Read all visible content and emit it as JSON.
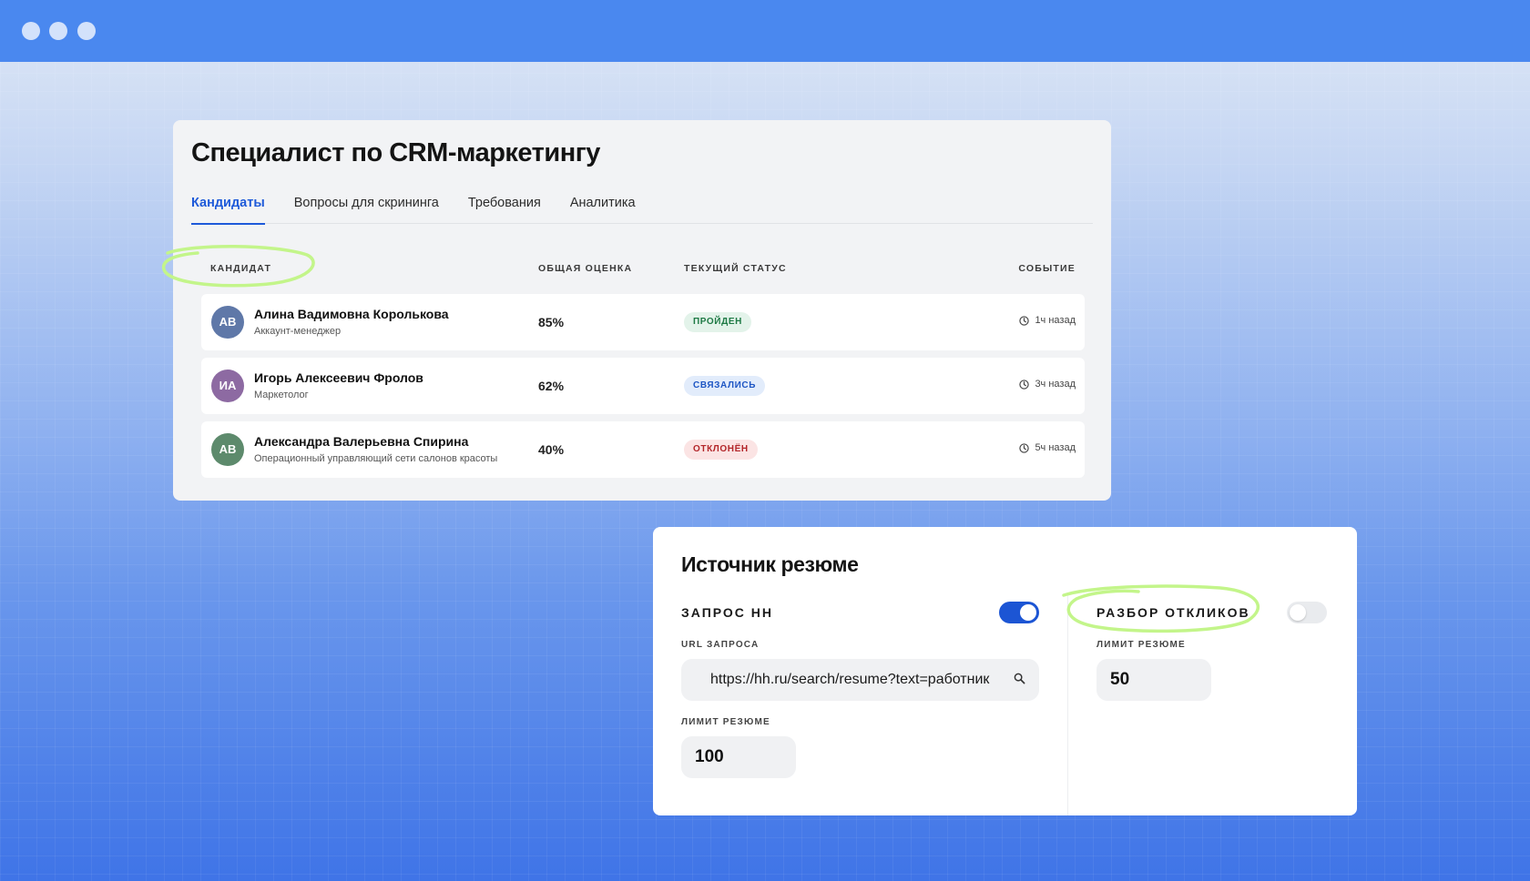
{
  "window": {
    "controls": [
      "dot",
      "dot",
      "dot"
    ]
  },
  "vacancy": {
    "title": "Специалист по CRM-маркетингу",
    "tabs": [
      {
        "label": "Кандидаты",
        "active": true
      },
      {
        "label": "Вопросы для скрининга",
        "active": false
      },
      {
        "label": "Требования",
        "active": false
      },
      {
        "label": "Аналитика",
        "active": false
      }
    ],
    "table": {
      "headers": {
        "candidate": "КАНДИДАТ",
        "score": "ОБЩАЯ ОЦЕНКА",
        "status": "ТЕКУЩИЙ СТАТУС",
        "event": "СОБЫТИЕ"
      },
      "rows": [
        {
          "initials": "АВ",
          "avatar_color": "#5f78a8",
          "name": "Алина Вадимовна Королькова",
          "role": "Аккаунт-менеджер",
          "score": "85%",
          "status": "ПРОЙДЕН",
          "status_bg": "#e3f3ea",
          "status_fg": "#1e7a45",
          "event": "1ч назад",
          "event_icon": "clock-icon"
        },
        {
          "initials": "ИА",
          "avatar_color": "#8d6aa2",
          "name": "Игорь Алексеевич Фролов",
          "role": "Маркетолог",
          "score": "62%",
          "status": "СВЯЗАЛИСЬ",
          "status_bg": "#e2ecfb",
          "status_fg": "#1e56c4",
          "event": "3ч назад",
          "event_icon": "clock-icon"
        },
        {
          "initials": "АВ",
          "avatar_color": "#5d8a6c",
          "name": "Александра Валерьевна Спирина",
          "role": "Операционный управляющий сети салонов красоты",
          "score": "40%",
          "status": "ОТКЛОНЁН",
          "status_bg": "#fbe4e4",
          "status_fg": "#b3262a",
          "event": "5ч назад",
          "event_icon": "clock-icon"
        }
      ]
    }
  },
  "source": {
    "title": "Источник резюме",
    "hh_request": {
      "label": "ЗАПРОС HH",
      "enabled": true,
      "url_label": "URL ЗАПРОСА",
      "url_value": "https://hh.ru/search/resume?text=работник",
      "url_icon": "search-icon",
      "limit_label": "ЛИМИТ РЕЗЮМЕ",
      "limit_value": "100"
    },
    "responses": {
      "label": "РАЗБОР ОТКЛИКОВ",
      "enabled": false,
      "limit_label": "ЛИМИТ РЕЗЮМЕ",
      "limit_value": "50"
    }
  },
  "colors": {
    "accent": "#1e5ad9",
    "toggle_on": "#1c55d4",
    "highlight_marker": "#c3f58a",
    "window_bar": "#4a88ef"
  }
}
